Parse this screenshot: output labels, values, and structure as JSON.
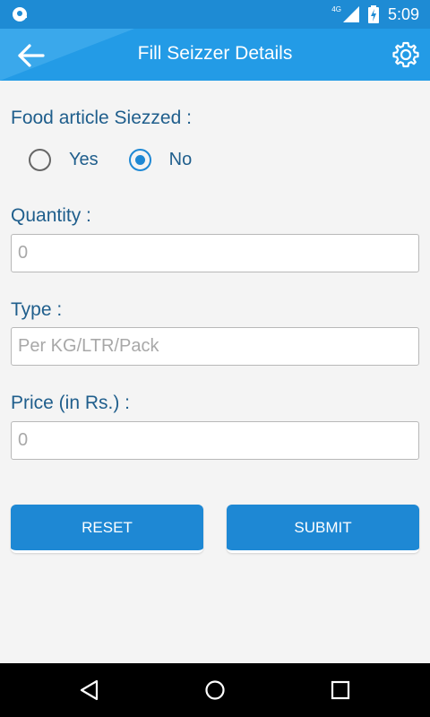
{
  "status_bar": {
    "time": "5:09",
    "network": "4G",
    "icons": [
      "notification-icon",
      "signal-icon",
      "battery-icon"
    ]
  },
  "app_bar": {
    "title": "Fill Seizzer Details",
    "back_icon": "arrow-back-icon",
    "settings_icon": "gear-icon"
  },
  "form": {
    "food_article_label": "Food article Siezzed :",
    "radio_yes_label": "Yes",
    "radio_no_label": "No",
    "selected": "No",
    "quantity_label": "Quantity :",
    "quantity_placeholder": "0",
    "type_label": "Type :",
    "type_placeholder": "Per KG/LTR/Pack",
    "price_label": "Price (in Rs.) :",
    "price_placeholder": "0"
  },
  "buttons": {
    "reset_label": "RESET",
    "submit_label": "SUBMIT"
  },
  "nav_bar": {
    "icons": [
      "back-triangle-icon",
      "home-circle-icon",
      "recents-square-icon"
    ]
  },
  "colors": {
    "accent": "#1e88d4",
    "app_bar": "#239be6",
    "status_bar": "#1e8bd4",
    "label_text": "#1f5e8c",
    "background": "#f4f4f4"
  }
}
